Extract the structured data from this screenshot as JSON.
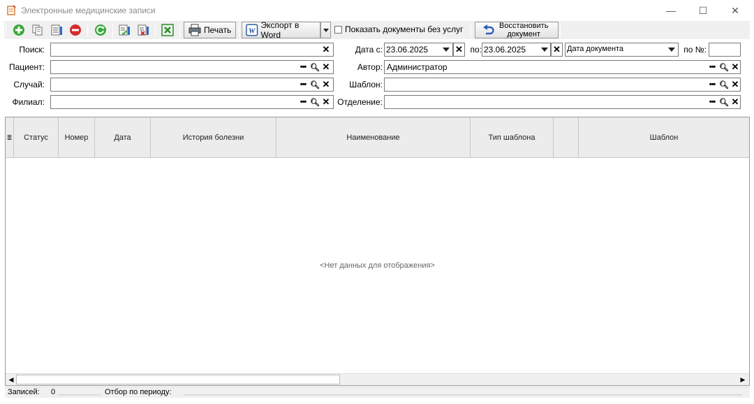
{
  "window": {
    "title": "Электронные медицинские записи",
    "minimize_glyph": "—",
    "maximize_glyph": "☐",
    "close_glyph": "✕"
  },
  "toolbar": {
    "print_label": "Печать",
    "export_label": "Экспорт в Word",
    "show_without_services_label": "Показать документы без услуг",
    "show_without_services_checked": false,
    "restore_label_line1": "Восстановить",
    "restore_label_line2": "документ",
    "icons": [
      "add-icon",
      "copy-icon",
      "document-icon",
      "delete-icon",
      "refresh-icon",
      "sign-document-icon",
      "unsign-document-icon",
      "excel-icon",
      "printer-icon",
      "word-icon",
      "undo-arrow-icon"
    ]
  },
  "filters": {
    "search_label": "Поиск:",
    "search_value": "",
    "patient_label": "Пациент:",
    "patient_value": "",
    "case_label": "Случай:",
    "case_value": "",
    "branch_label": "Филиал:",
    "branch_value": "",
    "date_from_label": "Дата с:",
    "date_from_value": "23.06.2025",
    "date_to_label": "по:",
    "date_to_value": "23.06.2025",
    "date_type_value": "Дата документа",
    "number_label": "по №:",
    "number_value": "",
    "author_label": "Автор:",
    "author_value": "Администратор",
    "template_label": "Шаблон:",
    "template_value": "",
    "department_label": "Отделение:",
    "department_value": ""
  },
  "grid": {
    "columns": [
      "Статус",
      "Номер",
      "Дата",
      "История болезни",
      "Наименование",
      "Тип шаблона",
      "",
      "Шаблон"
    ],
    "rows": [],
    "empty_message": "<Нет данных для отображения>"
  },
  "status": {
    "records_label": "Записей:",
    "records_count": "0",
    "period_label": "Отбор по периоду:"
  }
}
